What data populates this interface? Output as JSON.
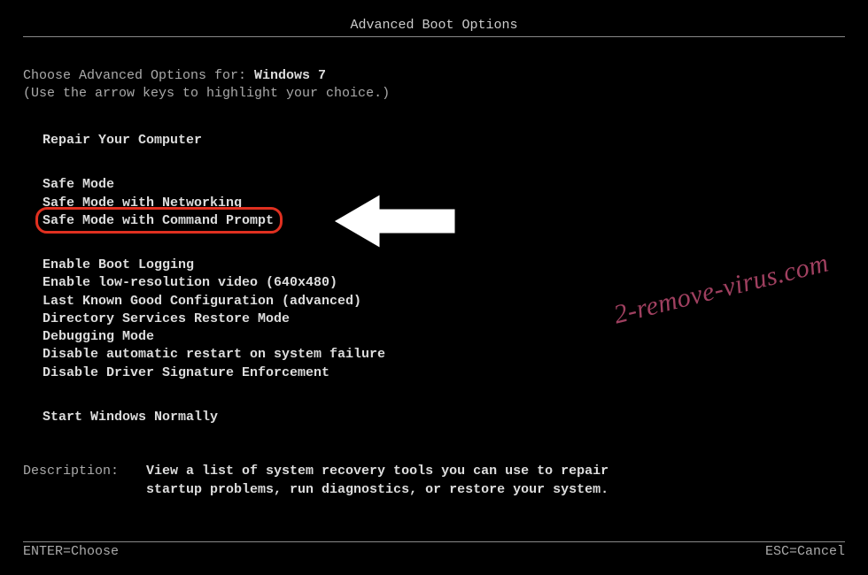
{
  "title": "Advanced Boot Options",
  "instructions": {
    "line1_prefix": "Choose Advanced Options for: ",
    "os_name": "Windows 7",
    "line2": "(Use the arrow keys to highlight your choice.)"
  },
  "groups": {
    "repair": "Repair Your Computer",
    "safe": [
      "Safe Mode",
      "Safe Mode with Networking",
      "Safe Mode with Command Prompt"
    ],
    "advanced": [
      "Enable Boot Logging",
      "Enable low-resolution video (640x480)",
      "Last Known Good Configuration (advanced)",
      "Directory Services Restore Mode",
      "Debugging Mode",
      "Disable automatic restart on system failure",
      "Disable Driver Signature Enforcement"
    ],
    "normal": "Start Windows Normally"
  },
  "description": {
    "label": "Description:",
    "text": "View a list of system recovery tools you can use to repair startup problems, run diagnostics, or restore your system."
  },
  "footer": {
    "enter": "ENTER=Choose",
    "esc": "ESC=Cancel"
  },
  "watermark": "2-remove-virus.com"
}
